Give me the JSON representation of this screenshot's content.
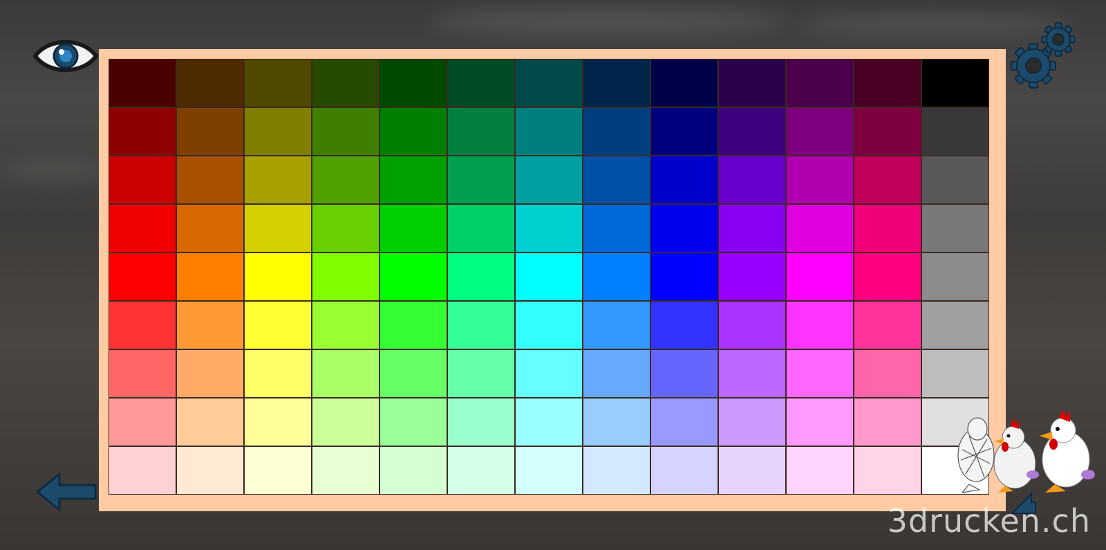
{
  "icons": {
    "view": "eye-icon",
    "settings": "gears-icon",
    "back": "arrow-left-icon",
    "forward": "arrow-right-icon"
  },
  "colors": {
    "panel_background": "#ffcba4",
    "icon_primary": "#1c4a6b",
    "icon_dark": "#1a1a1a"
  },
  "palette": {
    "rows": [
      [
        "#4a0000",
        "#4f2a00",
        "#4f4a00",
        "#254a00",
        "#004a00",
        "#004a25",
        "#004a4a",
        "#00254a",
        "#00004a",
        "#2a004a",
        "#4a004a",
        "#4a0025",
        "#000000"
      ],
      [
        "#8f0000",
        "#7f3f00",
        "#7f7f00",
        "#3f7f00",
        "#007f00",
        "#007f3f",
        "#007f7f",
        "#003f7f",
        "#00007f",
        "#3f007f",
        "#7f007f",
        "#7f003f",
        "#383838"
      ],
      [
        "#cc0000",
        "#a85000",
        "#a8a000",
        "#50a000",
        "#00a000",
        "#00a050",
        "#00a0a0",
        "#0050a8",
        "#0000cc",
        "#6a00cc",
        "#b000b0",
        "#c0005a",
        "#585858"
      ],
      [
        "#f00000",
        "#d86800",
        "#d4d000",
        "#68d000",
        "#00d000",
        "#00d068",
        "#00d0d0",
        "#0068d8",
        "#0000f0",
        "#8800f0",
        "#e000e0",
        "#f00078",
        "#787878"
      ],
      [
        "#ff0000",
        "#ff8000",
        "#ffff00",
        "#80ff00",
        "#00ff00",
        "#00ff80",
        "#00ffff",
        "#0080ff",
        "#0000ff",
        "#9900ff",
        "#ff00ff",
        "#ff0080",
        "#8c8c8c"
      ],
      [
        "#ff3333",
        "#ff9933",
        "#ffff33",
        "#99ff33",
        "#33ff33",
        "#33ff99",
        "#33ffff",
        "#3399ff",
        "#3333ff",
        "#aa33ff",
        "#ff33ff",
        "#ff3399",
        "#a0a0a0"
      ],
      [
        "#ff6666",
        "#ffaa66",
        "#ffff66",
        "#aaff66",
        "#66ff66",
        "#66ffaa",
        "#66ffff",
        "#66aaff",
        "#6666ff",
        "#bb66ff",
        "#ff66ff",
        "#ff66aa",
        "#bdbdbd"
      ],
      [
        "#ff9999",
        "#ffcc99",
        "#ffff99",
        "#ccff99",
        "#99ff99",
        "#99ffcc",
        "#99ffff",
        "#99ccff",
        "#9999ff",
        "#cc99ff",
        "#ff99ff",
        "#ff99cc",
        "#e0e0e0"
      ],
      [
        "#ffd0d4",
        "#ffe8d4",
        "#ffffd4",
        "#e8ffd4",
        "#d4ffd4",
        "#d4ffe8",
        "#d4ffff",
        "#d4e8ff",
        "#d4d4ff",
        "#e6d4ff",
        "#ffd4ff",
        "#ffd4e8",
        "#ffffff"
      ]
    ]
  },
  "branding": {
    "logo": "chicken-logo",
    "watermark": "3drucken.ch"
  }
}
